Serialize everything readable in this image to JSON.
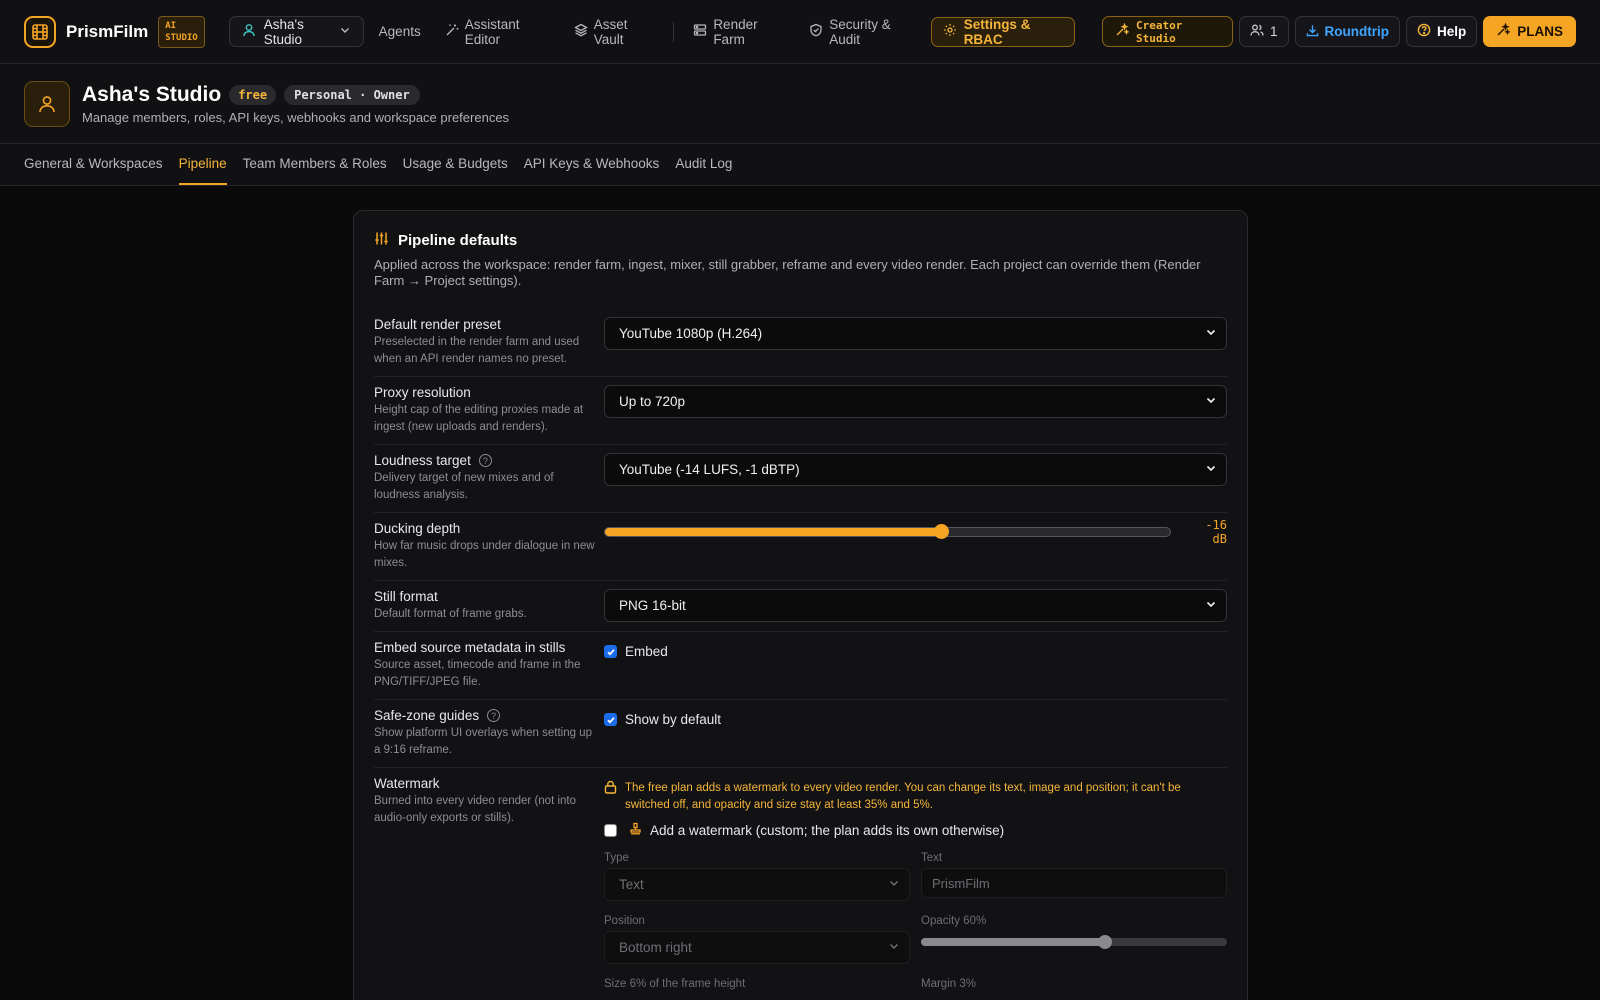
{
  "app": {
    "name": "PrismFilm",
    "badge_line1": "AI",
    "badge_line2": "STUDIO"
  },
  "workspace_switcher": {
    "label": "Asha's Studio"
  },
  "nav": {
    "agents": "Agents",
    "assistant_editor": "Assistant Editor",
    "asset_vault": "Asset Vault",
    "render_farm": "Render Farm",
    "security_audit": "Security & Audit",
    "settings_rbac": "Settings & RBAC",
    "creator_studio": "Creator Studio",
    "members_count": "1",
    "roundtrip": "Roundtrip",
    "help": "Help",
    "plans": "PLANS"
  },
  "header": {
    "title": "Asha's Studio",
    "plan_chip": "free",
    "role_chip": "Personal · Owner",
    "subtitle": "Manage members, roles, API keys, webhooks and workspace preferences"
  },
  "tabs": [
    {
      "label": "General & Workspaces",
      "active": false
    },
    {
      "label": "Pipeline",
      "active": true
    },
    {
      "label": "Team Members & Roles",
      "active": false
    },
    {
      "label": "Usage & Budgets",
      "active": false
    },
    {
      "label": "API Keys & Webhooks",
      "active": false
    },
    {
      "label": "Audit Log",
      "active": false
    }
  ],
  "card": {
    "title": "Pipeline defaults",
    "description": "Applied across the workspace: render farm, ingest, mixer, still grabber, reframe and every video render. Each project can override them (Render Farm → Project settings).",
    "render_preset": {
      "label": "Default render preset",
      "hint": "Preselected in the render farm and used when an API render names no preset.",
      "value": "YouTube 1080p (H.264)"
    },
    "proxy": {
      "label": "Proxy resolution",
      "hint": "Height cap of the editing proxies made at ingest (new uploads and renders).",
      "value": "Up to 720p"
    },
    "loudness": {
      "label": "Loudness target",
      "hint": "Delivery target of new mixes and of loudness analysis.",
      "value": "YouTube (-14 LUFS, -1 dBTP)"
    },
    "ducking": {
      "label": "Ducking depth",
      "hint": "How far music drops under dialogue in new mixes.",
      "value_text": "-16 dB",
      "fraction": 0.595
    },
    "still_format": {
      "label": "Still format",
      "hint": "Default format of frame grabs.",
      "value": "PNG 16-bit"
    },
    "embed_meta": {
      "label": "Embed source metadata in stills",
      "hint": "Source asset, timecode and frame in the PNG/TIFF/JPEG file.",
      "check_label": "Embed",
      "checked": true
    },
    "safe_zone": {
      "label": "Safe-zone guides",
      "hint": "Show platform UI overlays when setting up a 9:16 reframe.",
      "check_label": "Show by default",
      "checked": true
    },
    "watermark": {
      "label": "Watermark",
      "hint": "Burned into every video render (not into audio-only exports or stills).",
      "notice": "The free plan adds a watermark to every video render. You can change its text, image and position; it can't be switched off, and opacity and size stay at least 35% and 5%.",
      "custom_label": "Add a watermark (custom; the plan adds its own otherwise)",
      "custom_checked": false,
      "type_label": "Type",
      "type_value": "Text",
      "text_label": "Text",
      "text_placeholder": "PrismFilm",
      "position_label": "Position",
      "position_value": "Bottom right",
      "opacity_label": "Opacity 60%",
      "opacity_fraction": 0.6,
      "size_label": "Size 6% of the frame height",
      "margin_label": "Margin 3%"
    }
  },
  "colors": {
    "accent": "#f5a524",
    "link_blue": "#3ea6ff",
    "checkbox_blue": "#1a6ce8"
  }
}
